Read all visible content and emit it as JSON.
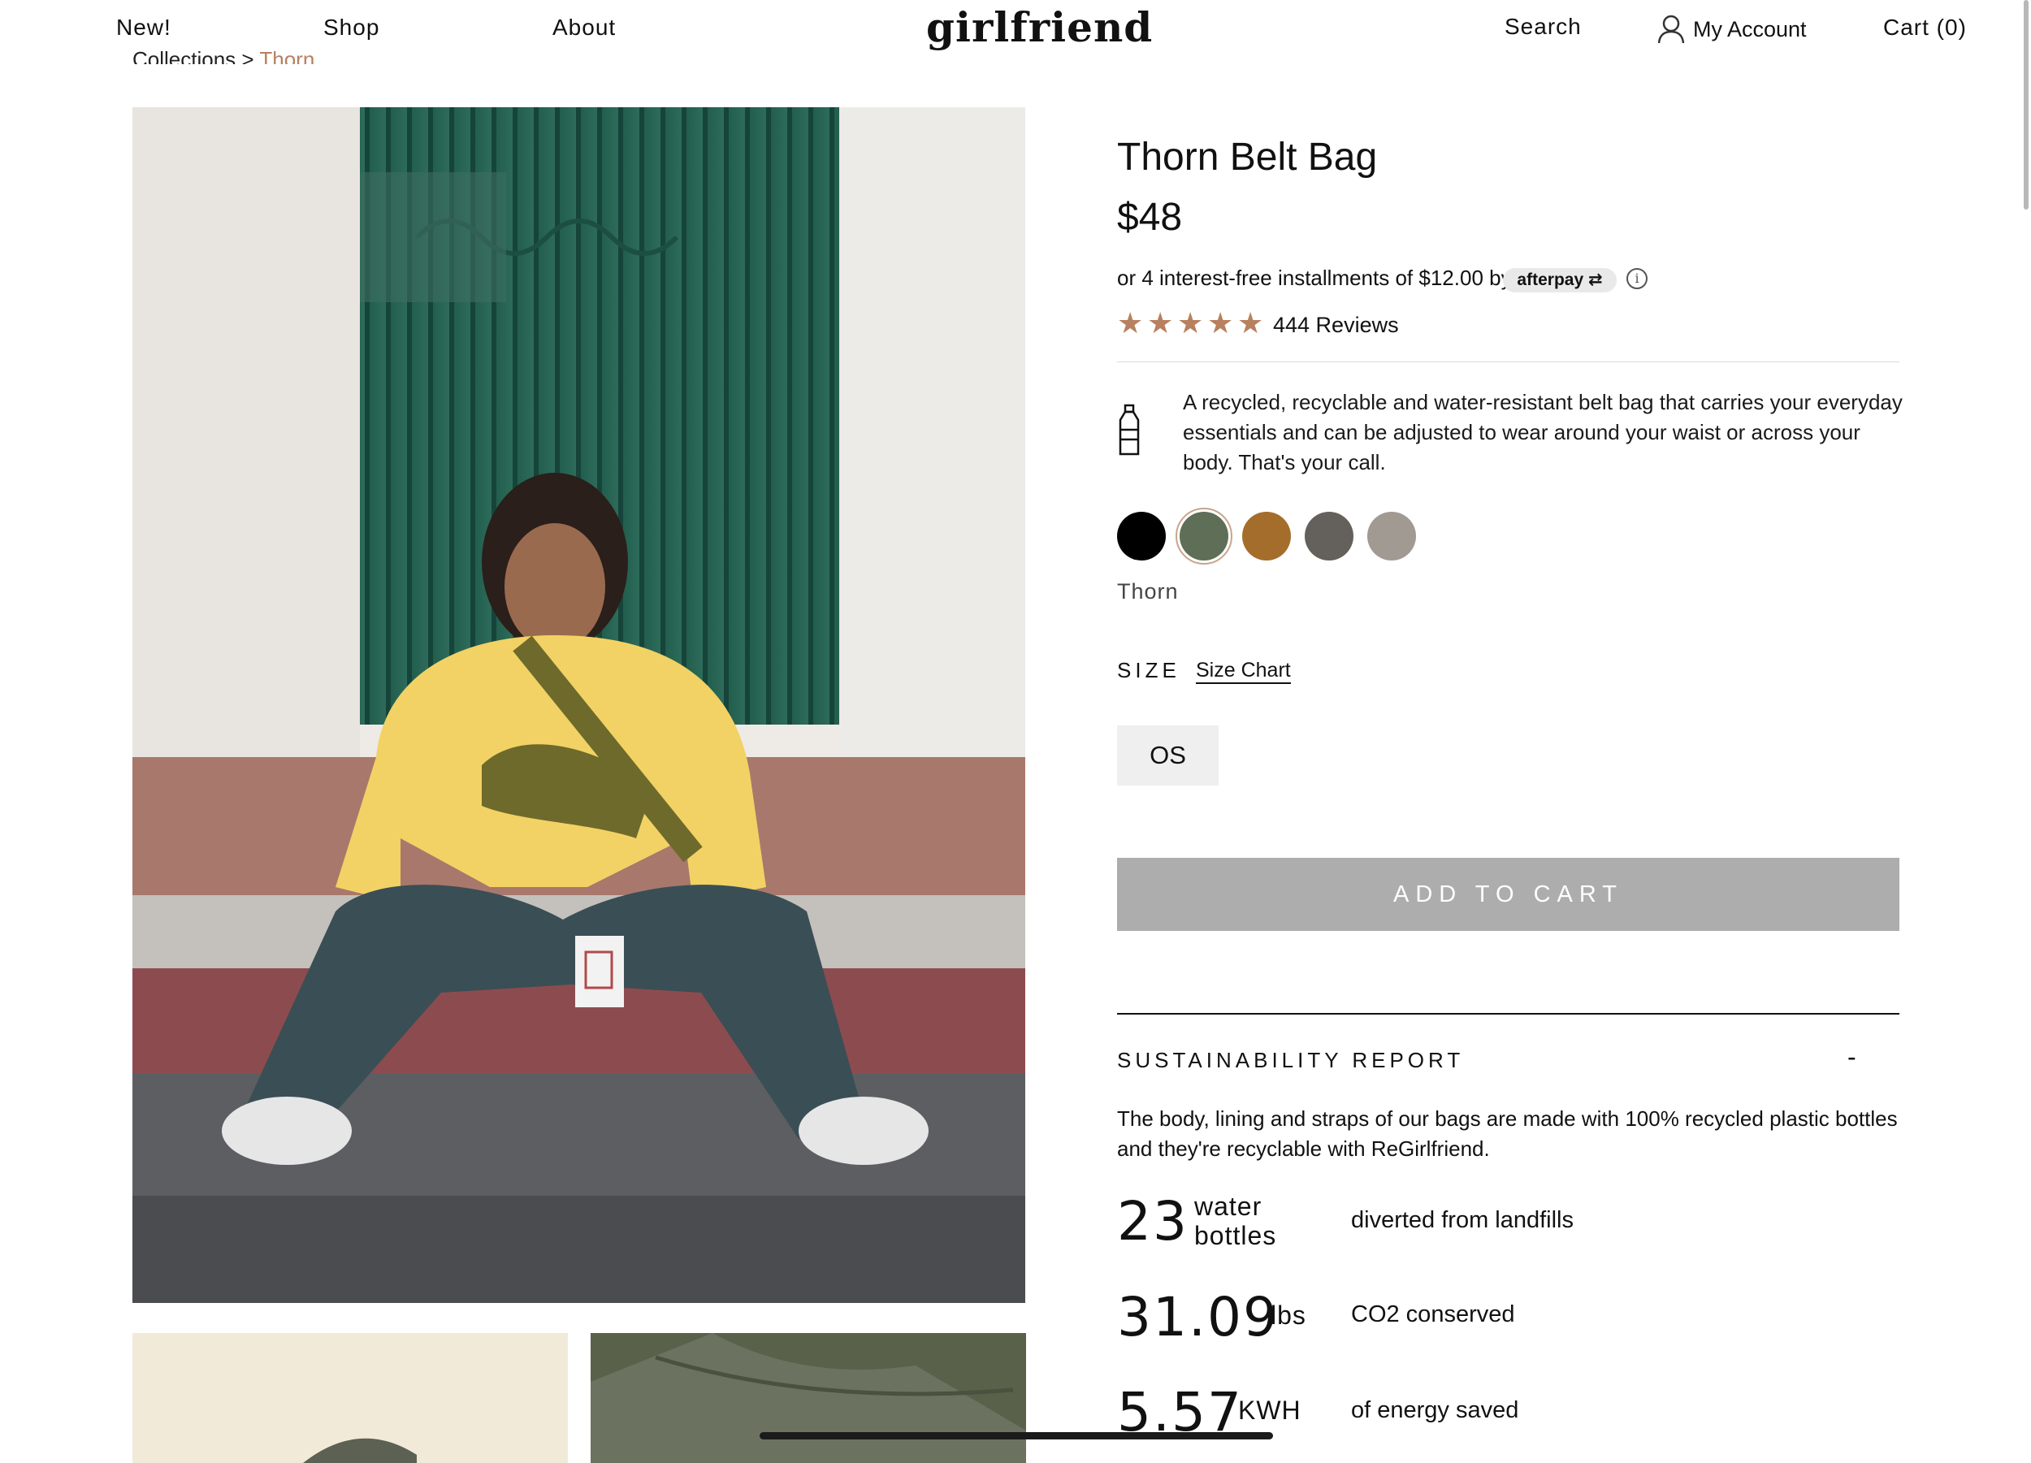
{
  "header": {
    "nav": [
      "New!",
      "Shop",
      "About"
    ],
    "logo": "girlfriend",
    "search": "Search",
    "account": "My Account",
    "cart": "Cart (0)"
  },
  "breadcrumb": {
    "parent": "Collections",
    "separator": ">",
    "current": "Thorn"
  },
  "product": {
    "title": "Thorn Belt Bag",
    "price": "$48",
    "installments": "or 4 interest-free installments of $12.00 by",
    "afterpay_label": "afterpay",
    "info_glyph": "i",
    "rating": 5,
    "reviews": "444 Reviews",
    "description": "A recycled, recyclable and water-resistant belt bag that carries your everyday essentials and can be adjusted to wear around your waist or across your body. That's your call.",
    "colors": [
      {
        "hex": "#000000",
        "selected": false
      },
      {
        "hex": "#5f6e56",
        "selected": true
      },
      {
        "hex": "#a56d2b",
        "selected": false
      },
      {
        "hex": "#64605b",
        "selected": false
      },
      {
        "hex": "#a19a92",
        "selected": false
      }
    ],
    "selected_color_name": "Thorn",
    "size_label": "SIZE",
    "size_chart_label": "Size Chart",
    "sizes": [
      "OS"
    ],
    "add_to_cart": "ADD TO CART"
  },
  "sustainability": {
    "title": "SUSTAINABILITY REPORT",
    "toggle": "-",
    "text": "The body, lining and straps of our bags are made with 100% recycled plastic bottles and they're recyclable with ReGirlfriend.",
    "stats": [
      {
        "value": "23",
        "unit": "water bottles",
        "desc": "diverted from landfills"
      },
      {
        "value": "31.09",
        "unit": "lbs",
        "desc": "CO2 conserved"
      },
      {
        "value": "5.57",
        "unit": "KWH",
        "desc": "of energy saved"
      }
    ]
  },
  "colors": {
    "accent": "#b8805f",
    "button_disabled": "#adadad"
  },
  "icons": [
    "user-icon",
    "star-icon",
    "info-icon",
    "bottle-icon"
  ]
}
